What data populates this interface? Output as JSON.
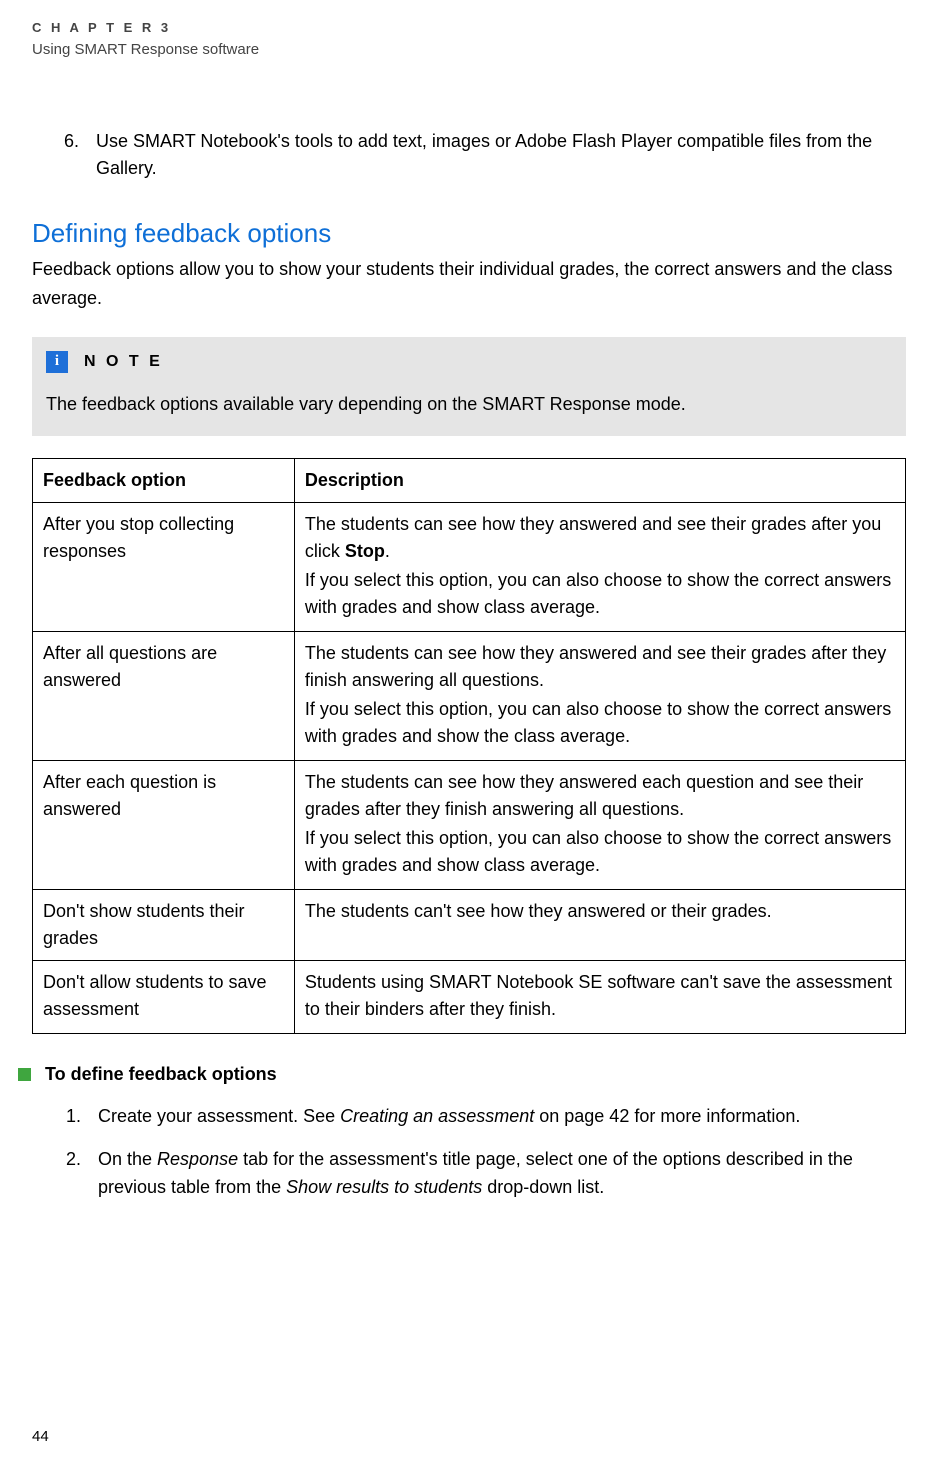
{
  "header": {
    "chapter": "C H A P T E R   3",
    "subtitle": "Using SMART Response software"
  },
  "intro_list": {
    "item6_number": "6.",
    "item6_text": "Use SMART Notebook's tools to add text, images or Adobe Flash Player compatible files from the Gallery."
  },
  "section": {
    "title": "Defining feedback options",
    "intro": "Feedback options allow you to show your students their individual grades, the correct answers and the class average."
  },
  "note": {
    "icon_text": "i",
    "label": "N O T E",
    "body": "The feedback options available vary depending on the SMART Response mode."
  },
  "table": {
    "header_option": "Feedback option",
    "header_description": "Description",
    "rows": [
      {
        "option": "After you stop collecting responses",
        "desc_p1_pre": "The students can see how they answered and see their grades after you click ",
        "desc_p1_bold": "Stop",
        "desc_p1_post": ".",
        "desc_p2": "If you select this option, you can also choose to show the correct answers with grades and show class average."
      },
      {
        "option": "After all questions are answered",
        "desc_p1": "The students can see how they answered and see their grades after they finish answering all questions.",
        "desc_p2": "If you select this option, you can also choose to show the correct answers with grades and show the class average."
      },
      {
        "option": "After each question is answered",
        "desc_p1": "The students can see how they answered each question and see their grades after they finish answering all questions.",
        "desc_p2": "If you select this option, you can also choose to show the correct answers with grades and show class average."
      },
      {
        "option": "Don't show students their grades",
        "desc_p1": "The students can't see how they answered or their grades."
      },
      {
        "option": "Don't allow students to save assessment",
        "desc_p1": "Students using SMART Notebook SE software can't save the assessment to their binders after they finish."
      }
    ]
  },
  "procedure": {
    "title": "To define feedback options",
    "items": [
      {
        "num": "1.",
        "pre": "Create your assessment. See ",
        "italic": "Creating an assessment",
        "post": " on page 42 for more information."
      },
      {
        "num": "2.",
        "pre": "On the ",
        "italic1": "Response",
        "mid": " tab for the assessment's title page, select one of the options described in the previous table from the ",
        "italic2": "Show results to students",
        "post": " drop-down list."
      }
    ]
  },
  "page_number": "44"
}
